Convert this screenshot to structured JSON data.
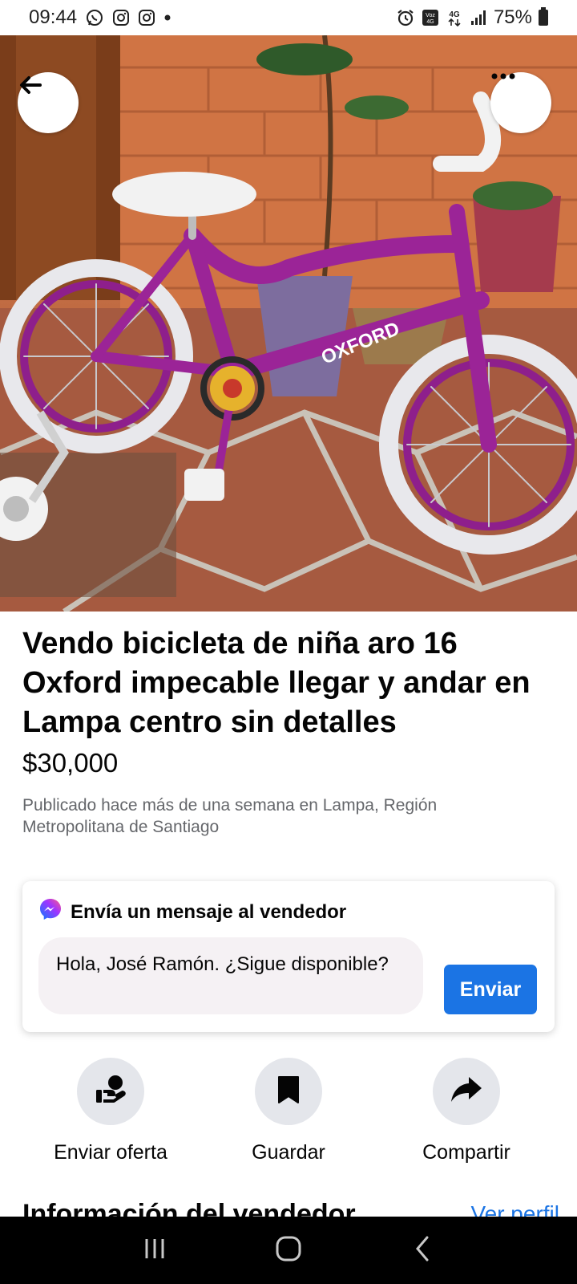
{
  "status_bar": {
    "time": "09:44",
    "battery": "75%",
    "icons": [
      "whatsapp-icon",
      "instagram-icon",
      "instagram-icon",
      "dot-icon",
      "alarm-icon",
      "volte-icon",
      "4g-icon",
      "signal-icon",
      "battery-icon"
    ]
  },
  "listing": {
    "title": "Vendo bicicleta de niña aro 16 Oxford impecable llegar y andar en Lampa centro sin detalles",
    "price": "$30,000",
    "posted": "Publicado hace más de una semana en Lampa, Región Metropolitana de Santiago"
  },
  "message_card": {
    "header": "Envía un mensaje al vendedor",
    "input_value": "Hola, José Ramón. ¿Sigue disponible?",
    "send_label": "Enviar"
  },
  "actions": [
    {
      "label": "Enviar oferta",
      "icon": "offer-icon"
    },
    {
      "label": "Guardar",
      "icon": "bookmark-icon"
    },
    {
      "label": "Compartir",
      "icon": "share-icon"
    }
  ],
  "seller": {
    "section_title": "Información del vendedor",
    "link": "Ver perfil"
  },
  "colors": {
    "accent": "#1b74e4",
    "action_circle": "#e4e6eb",
    "secondary_text": "#65676b",
    "bike_frame": "#8e1f8c"
  }
}
